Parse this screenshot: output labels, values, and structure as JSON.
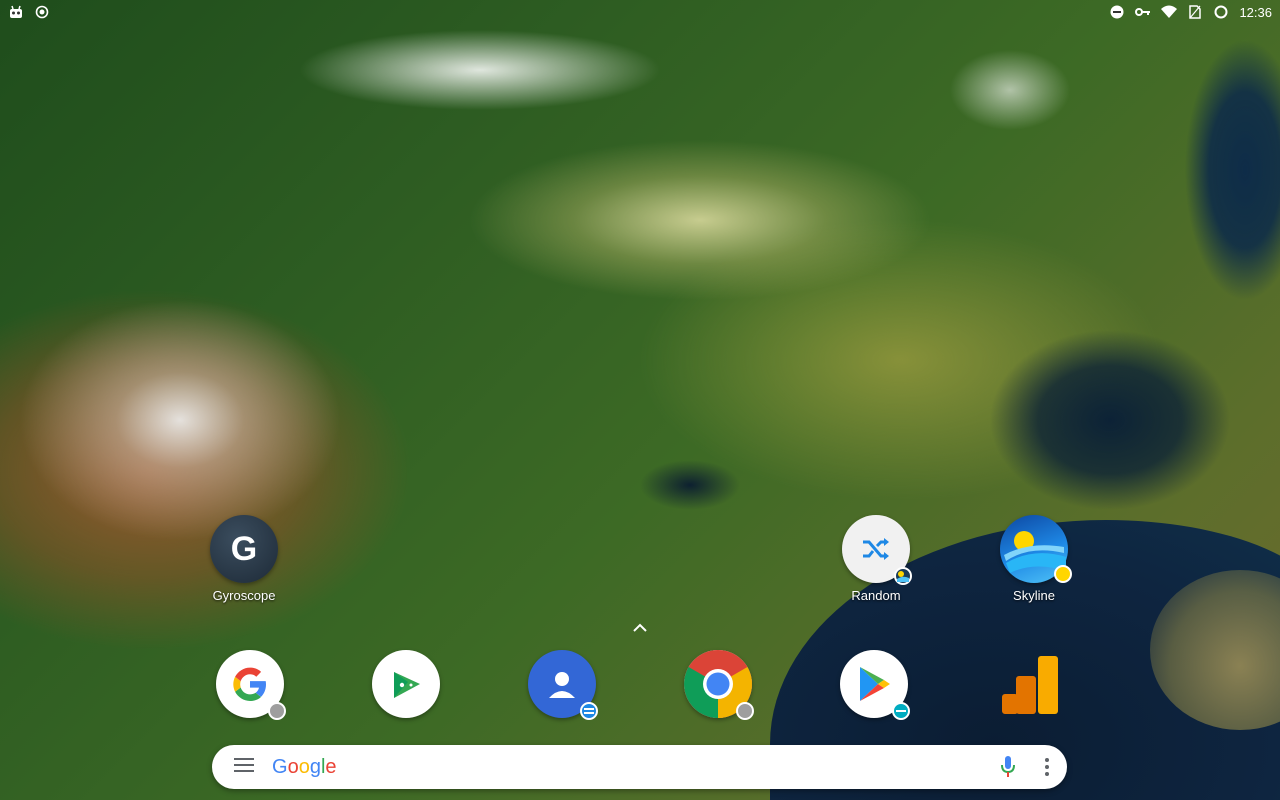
{
  "status_bar": {
    "time": "12:36",
    "left_icons": [
      "robot-notification-icon",
      "record-icon"
    ],
    "right_icons": [
      "do-not-disturb-icon",
      "vpn-key-icon",
      "wifi-icon",
      "no-sim-icon",
      "battery-circle-icon"
    ]
  },
  "apps": {
    "gyroscope": {
      "label": "Gyroscope",
      "glyph": "G",
      "color": "#2b3a4a"
    },
    "random": {
      "label": "Random",
      "color": "#f1f1f1"
    },
    "skyline": {
      "label": "Skyline",
      "color": "#1e88e5"
    }
  },
  "dock": [
    {
      "name": "google-app-icon",
      "app": "Google"
    },
    {
      "name": "google-play-games-icon",
      "app": "Play Games"
    },
    {
      "name": "contacts-icon",
      "app": "Contacts"
    },
    {
      "name": "chrome-icon",
      "app": "Chrome"
    },
    {
      "name": "play-store-icon",
      "app": "Play Store"
    },
    {
      "name": "google-analytics-icon",
      "app": "Analytics"
    }
  ],
  "search": {
    "logo_letters": [
      {
        "ch": "G",
        "color": "#4285F4"
      },
      {
        "ch": "o",
        "color": "#EA4335"
      },
      {
        "ch": "o",
        "color": "#FBBC05"
      },
      {
        "ch": "g",
        "color": "#4285F4"
      },
      {
        "ch": "l",
        "color": "#34A853"
      },
      {
        "ch": "e",
        "color": "#EA4335"
      }
    ]
  }
}
